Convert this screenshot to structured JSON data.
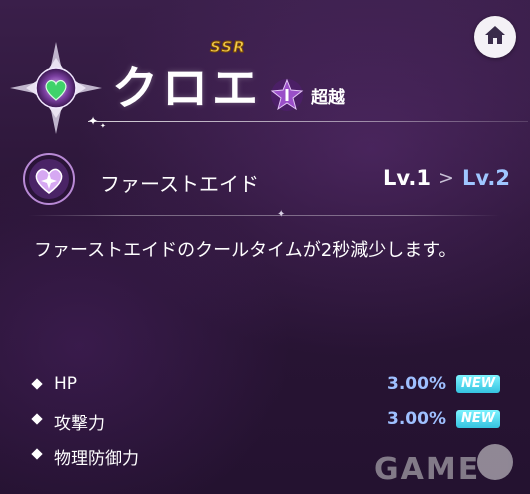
{
  "header": {
    "rarity": "SSR",
    "character_name": "クロエ",
    "rank_label": "超越",
    "rank_badge_icon": "star-rank-icon",
    "home_icon": "home-icon"
  },
  "skill": {
    "icon": "heart-sparkle-icon",
    "name": "ファーストエイド",
    "level_from": "Lv.1",
    "level_arrow": ">",
    "level_to": "Lv.2",
    "description": "ファーストエイドのクールタイムが2秒減少します。"
  },
  "stats": [
    {
      "label": "HP",
      "value": "3.00%",
      "badge": "NEW"
    },
    {
      "label": "攻撃力",
      "value": "3.00%",
      "badge": "NEW"
    },
    {
      "label": "物理防御力",
      "value": "",
      "badge": ""
    }
  ],
  "colors": {
    "background": "#2a1536",
    "accent_blue": "#9fc6ff",
    "new_badge": "#35c3e0",
    "ssr_gold": "#f3c94c"
  }
}
